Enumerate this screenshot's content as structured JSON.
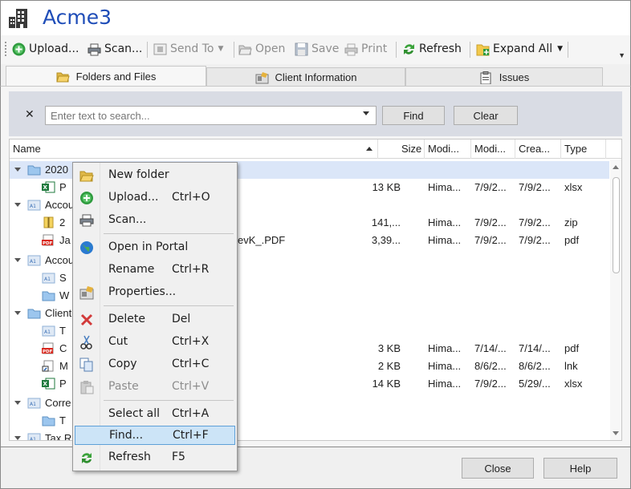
{
  "window": {
    "title": "Acme3"
  },
  "toolbar": {
    "upload": "Upload...",
    "scan": "Scan...",
    "send_to": "Send To",
    "open": "Open",
    "save": "Save",
    "print": "Print",
    "refresh": "Refresh",
    "expand_all": "Expand All"
  },
  "tabs": [
    {
      "label": "Folders and Files",
      "active": true
    },
    {
      "label": "Client Information",
      "active": false
    },
    {
      "label": "Issues",
      "active": false
    }
  ],
  "search": {
    "clear_icon": "x-icon",
    "placeholder": "Enter text to search...",
    "find_label": "Find",
    "clear_label": "Clear"
  },
  "grid": {
    "columns": [
      "Name",
      "Size",
      "Modi...",
      "Modi...",
      "Crea...",
      "Type"
    ],
    "rows": [
      {
        "name": "2020",
        "icon": "folder-icon",
        "size": "",
        "mod_by": "",
        "modified": "",
        "created": "",
        "type": "",
        "selected": true
      },
      {
        "name": "P",
        "icon": "excel-icon",
        "size": "13 KB",
        "mod_by": "Hima...",
        "modified": "7/9/2...",
        "created": "7/9/2...",
        "type": "xlsx"
      },
      {
        "name": "Accou",
        "icon": "sorted-folder-icon",
        "size": "",
        "mod_by": "",
        "modified": "",
        "created": "",
        "type": ""
      },
      {
        "name": "2",
        "icon": "zip-icon",
        "size": "141,...",
        "mod_by": "Hima...",
        "modified": "7/9/2...",
        "created": "7/9/2...",
        "type": "zip"
      },
      {
        "name": "Ja",
        "trailing": "evK_.PDF",
        "icon": "pdf-icon",
        "size": "3,39...",
        "mod_by": "Hima...",
        "modified": "7/9/2...",
        "created": "7/9/2...",
        "type": "pdf"
      },
      {
        "name": "Accou",
        "icon": "sorted-folder-icon",
        "size": "",
        "mod_by": "",
        "modified": "",
        "created": "",
        "type": ""
      },
      {
        "name": "S",
        "icon": "sorted-folder-icon",
        "size": "",
        "mod_by": "",
        "modified": "",
        "created": "",
        "type": ""
      },
      {
        "name": "W",
        "icon": "folder-icon",
        "size": "",
        "mod_by": "",
        "modified": "",
        "created": "",
        "type": ""
      },
      {
        "name": "Client",
        "icon": "folder-icon",
        "size": "",
        "mod_by": "",
        "modified": "",
        "created": "",
        "type": ""
      },
      {
        "name": "T",
        "icon": "sorted-folder-icon",
        "size": "",
        "mod_by": "",
        "modified": "",
        "created": "",
        "type": ""
      },
      {
        "name": "C",
        "icon": "pdf-icon",
        "size": "3 KB",
        "mod_by": "Hima...",
        "modified": "7/14/...",
        "created": "7/14/...",
        "type": "pdf"
      },
      {
        "name": "M",
        "icon": "shortcut-icon",
        "size": "2 KB",
        "mod_by": "Hima...",
        "modified": "8/6/2...",
        "created": "8/6/2...",
        "type": "lnk"
      },
      {
        "name": "P",
        "icon": "excel-icon",
        "size": "14 KB",
        "mod_by": "Hima...",
        "modified": "7/9/2...",
        "created": "5/29/...",
        "type": "xlsx"
      },
      {
        "name": "Corre",
        "icon": "sorted-folder-icon",
        "size": "",
        "mod_by": "",
        "modified": "",
        "created": "",
        "type": ""
      },
      {
        "name": "T",
        "icon": "folder-icon",
        "size": "",
        "mod_by": "",
        "modified": "",
        "created": "",
        "type": ""
      },
      {
        "name": "Tax R",
        "icon": "sorted-folder-icon",
        "size": "",
        "mod_by": "",
        "modified": "",
        "created": "",
        "type": ""
      }
    ]
  },
  "context_menu": {
    "items": [
      {
        "label": "New folder",
        "shortcut": "",
        "icon": "open-folder-icon"
      },
      {
        "label": "Upload...",
        "shortcut": "Ctrl+O",
        "icon": "upload-icon"
      },
      {
        "label": "Scan...",
        "shortcut": "",
        "icon": "scanner-icon"
      },
      {
        "label": "Open in Portal",
        "shortcut": "",
        "icon": "globe-icon"
      },
      {
        "label": "Rename",
        "shortcut": "Ctrl+R",
        "icon": ""
      },
      {
        "label": "Properties...",
        "shortcut": "",
        "icon": "properties-icon"
      },
      {
        "label": "Delete",
        "shortcut": "Del",
        "icon": "delete-icon"
      },
      {
        "label": "Cut",
        "shortcut": "Ctrl+X",
        "icon": "scissors-icon"
      },
      {
        "label": "Copy",
        "shortcut": "Ctrl+C",
        "icon": "copy-icon"
      },
      {
        "label": "Paste",
        "shortcut": "Ctrl+V",
        "icon": "paste-icon",
        "disabled": true
      },
      {
        "label": "Select all",
        "shortcut": "Ctrl+A",
        "icon": ""
      },
      {
        "label": "Find...",
        "shortcut": "Ctrl+F",
        "icon": "",
        "highlighted": true
      },
      {
        "label": "Refresh",
        "shortcut": "F5",
        "icon": "refresh-icon"
      }
    ]
  },
  "footer": {
    "close_label": "Close",
    "help_label": "Help"
  },
  "colors": {
    "title": "#1f4db8",
    "selection": "#dbe6f8",
    "menu_highlight": "#cce4f7",
    "search_band": "#d9dce4"
  }
}
